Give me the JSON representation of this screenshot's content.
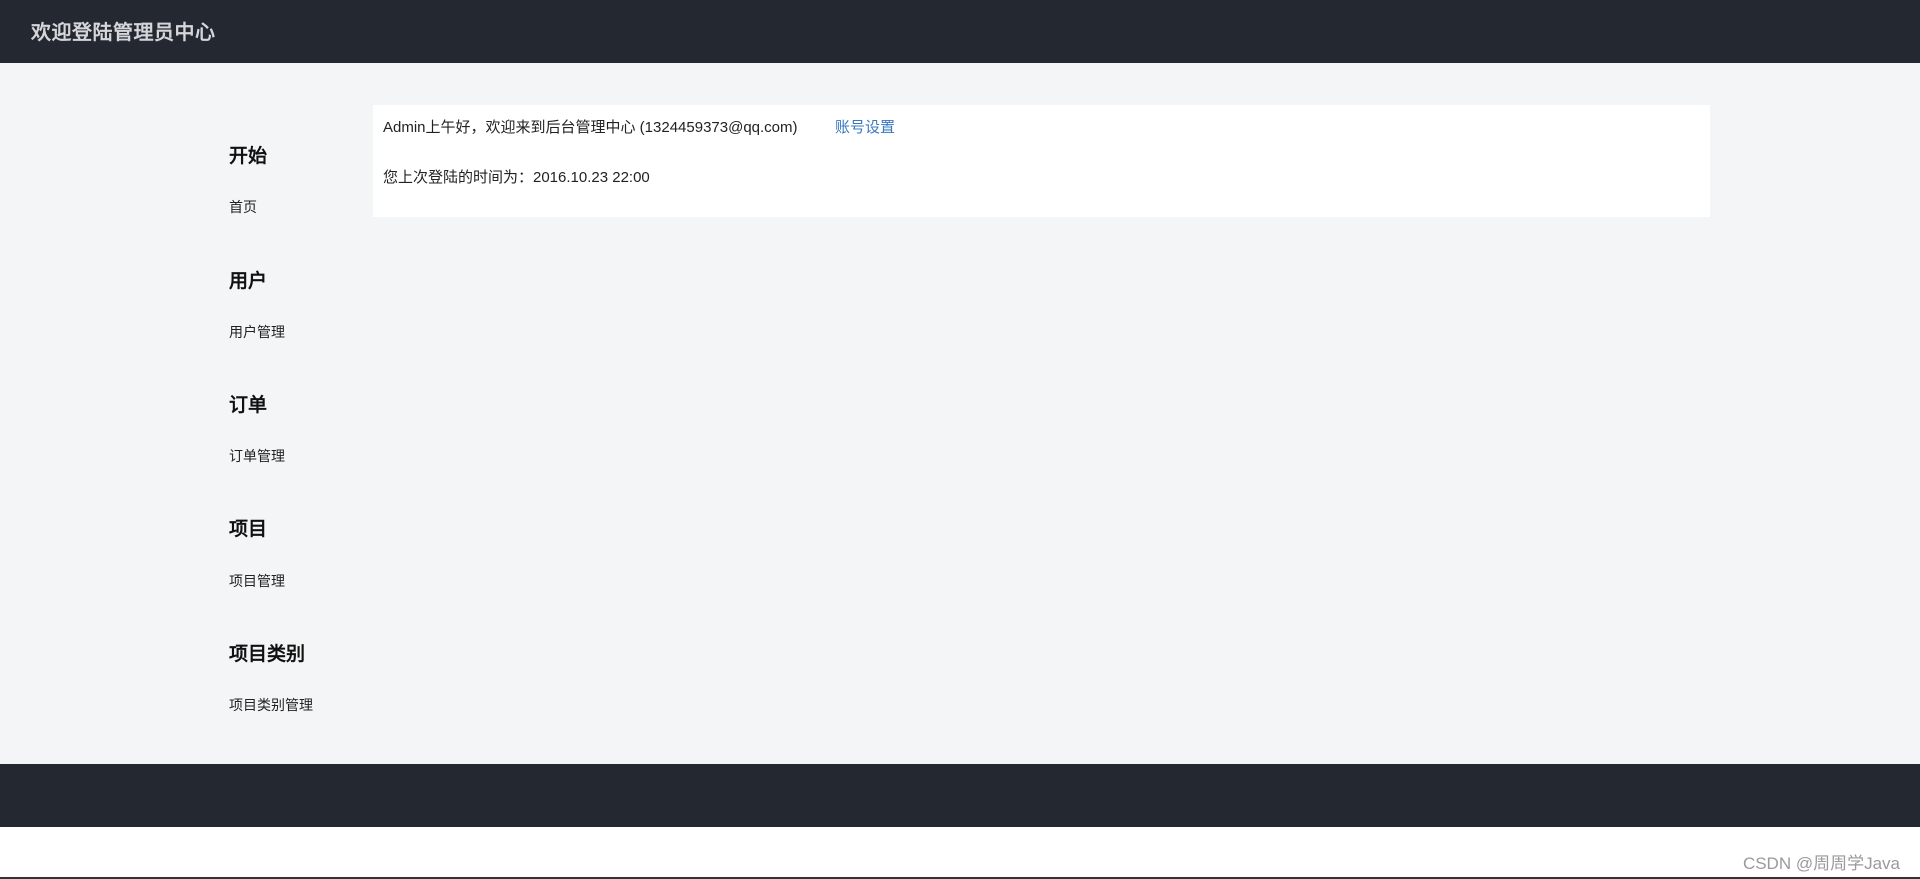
{
  "header": {
    "title": "欢迎登陆管理员中心"
  },
  "sidebar": {
    "groups": [
      {
        "title": "开始",
        "item": "首页"
      },
      {
        "title": "用户",
        "item": "用户管理"
      },
      {
        "title": "订单",
        "item": "订单管理"
      },
      {
        "title": "项目",
        "item": "项目管理"
      },
      {
        "title": "项目类别",
        "item": "项目类别管理"
      }
    ]
  },
  "main": {
    "welcome": "Admin上午好，欢迎来到后台管理中心 (1324459373@qq.com)",
    "account_link": "账号设置",
    "last_login": "您上次登陆的时间为：2016.10.23 22:00"
  },
  "watermark": "CSDN @周周学Java",
  "colors": {
    "header_bg": "#242830",
    "content_bg": "#f4f5f7",
    "link": "#3a78c0"
  }
}
